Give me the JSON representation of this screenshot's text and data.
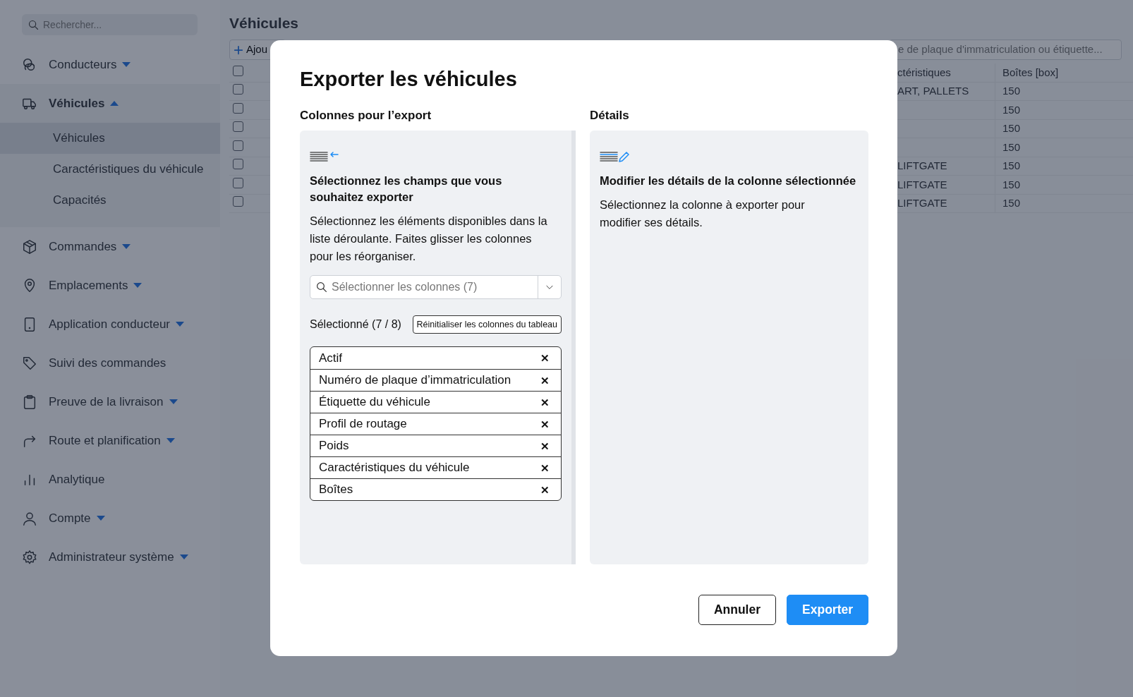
{
  "sidebar": {
    "search": {
      "placeholder": "Rechercher..."
    },
    "items": [
      {
        "label": "Conducteurs",
        "expandable": true,
        "expanded": false
      },
      {
        "label": "Véhicules",
        "expandable": true,
        "expanded": true,
        "children": [
          {
            "label": "Véhicules",
            "selected": true
          },
          {
            "label": "Caractéristiques du véhicule",
            "selected": false
          },
          {
            "label": "Capacités",
            "selected": false
          }
        ]
      },
      {
        "label": "Commandes",
        "expandable": true,
        "expanded": false
      },
      {
        "label": "Emplacements",
        "expandable": true,
        "expanded": false
      },
      {
        "label": "Application conducteur",
        "expandable": true,
        "expanded": false
      },
      {
        "label": "Suivi des commandes",
        "expandable": false,
        "expanded": false
      },
      {
        "label": "Preuve de la livraison",
        "expandable": true,
        "expanded": false
      },
      {
        "label": "Route et planification",
        "expandable": true,
        "expanded": false
      },
      {
        "label": "Analytique",
        "expandable": false,
        "expanded": false
      },
      {
        "label": "Compte",
        "expandable": true,
        "expanded": false
      },
      {
        "label": "Administrateur système",
        "expandable": true,
        "expanded": false
      }
    ]
  },
  "page": {
    "title": "Véhicules",
    "add_button": "Ajou",
    "search": {
      "placeholder": "e de plaque d'immatriculation ou étiquette..."
    },
    "table": {
      "header_checked": false,
      "columns": [
        "ctéristiques",
        "Boîtes [box]"
      ],
      "rows": [
        {
          "checked": false,
          "cells": [
            "ART, PALLETS",
            "150"
          ]
        },
        {
          "checked": false,
          "cells": [
            "",
            "150"
          ]
        },
        {
          "checked": false,
          "cells": [
            "",
            "150"
          ]
        },
        {
          "checked": false,
          "cells": [
            "",
            "150"
          ]
        },
        {
          "checked": false,
          "cells": [
            "LIFTGATE",
            "150"
          ]
        },
        {
          "checked": false,
          "cells": [
            "LIFTGATE",
            "150"
          ]
        },
        {
          "checked": false,
          "cells": [
            "LIFTGATE",
            "150"
          ]
        }
      ]
    }
  },
  "modal": {
    "title": "Exporter les véhicules",
    "columns_panel": {
      "label": "Colonnes pour l’export",
      "heading": "Sélectionnez les champs que vous souhaitez exporter",
      "text": "Sélectionnez les éléments disponibles dans la liste déroulante. Faites glisser les colonnes pour les réorganiser.",
      "select": {
        "placeholder": "Sélectionner les colonnes (7)"
      },
      "selected_count": "Sélectionné (7 / 8)",
      "reset_button": "Réinitialiser les colonnes du tableau",
      "selected_columns": [
        "Actif",
        "Numéro de plaque d’immatriculation",
        "Étiquette du véhicule",
        "Profil de routage",
        "Poids",
        "Caractéristiques du véhicule",
        "Boîtes"
      ],
      "remove_symbol": "✕"
    },
    "details_panel": {
      "label": "Détails",
      "heading": "Modifier les détails de la colonne sélectionnée",
      "text": "Sélectionnez la colonne à exporter pour modifier ses détails."
    },
    "buttons": [
      {
        "label": "Annuler",
        "kind": "secondary"
      },
      {
        "label": "Exporter",
        "kind": "primary"
      }
    ]
  }
}
